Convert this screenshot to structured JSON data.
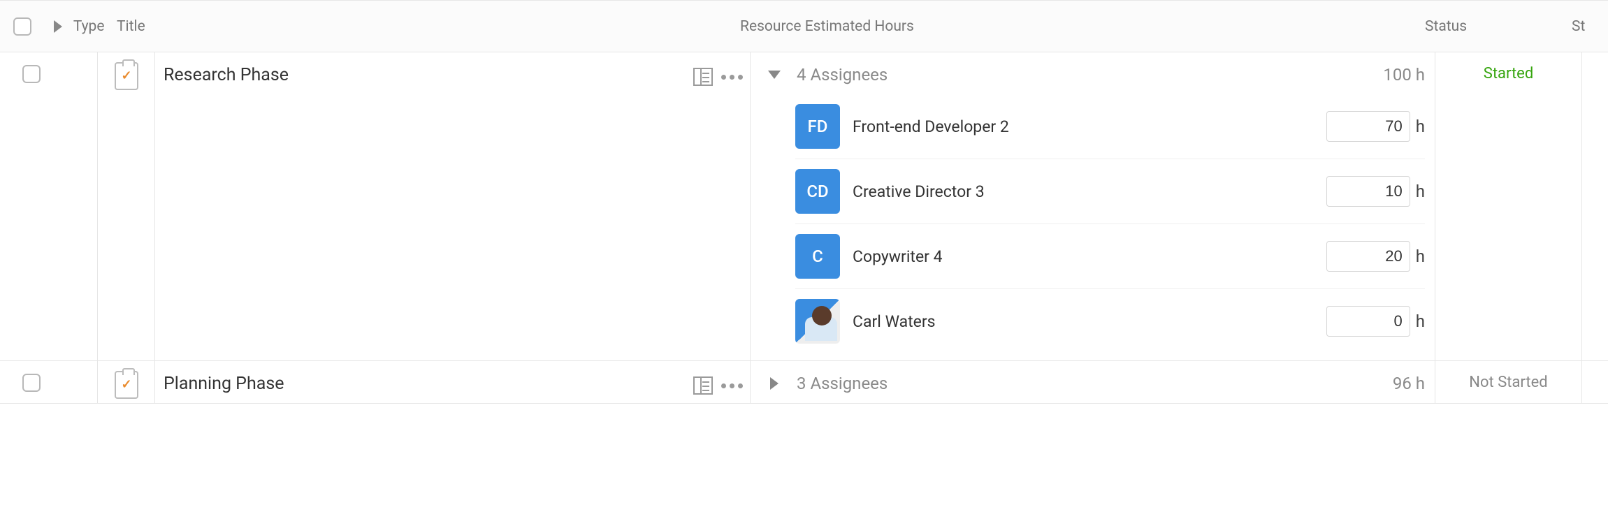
{
  "columns": {
    "type": "Type",
    "title": "Title",
    "resource": "Resource Estimated Hours",
    "status": "Status",
    "status2": "St"
  },
  "hours_unit": "h",
  "rows": [
    {
      "title": "Research Phase",
      "assignee_summary": "4 Assignees",
      "total_hours": "100 h",
      "status": "Started",
      "status_class": "status-started",
      "expanded": true,
      "assignees": [
        {
          "initials": "FD",
          "name": "Front-end Developer 2",
          "hours": "70",
          "photo": false
        },
        {
          "initials": "CD",
          "name": "Creative Director 3",
          "hours": "10",
          "photo": false
        },
        {
          "initials": "C",
          "name": "Copywriter 4",
          "hours": "20",
          "photo": false
        },
        {
          "initials": "",
          "name": "Carl Waters",
          "hours": "0",
          "photo": true
        }
      ]
    },
    {
      "title": "Planning Phase",
      "assignee_summary": "3 Assignees",
      "total_hours": "96 h",
      "status": "Not Started",
      "status_class": "status-notstarted",
      "expanded": false,
      "assignees": []
    }
  ]
}
